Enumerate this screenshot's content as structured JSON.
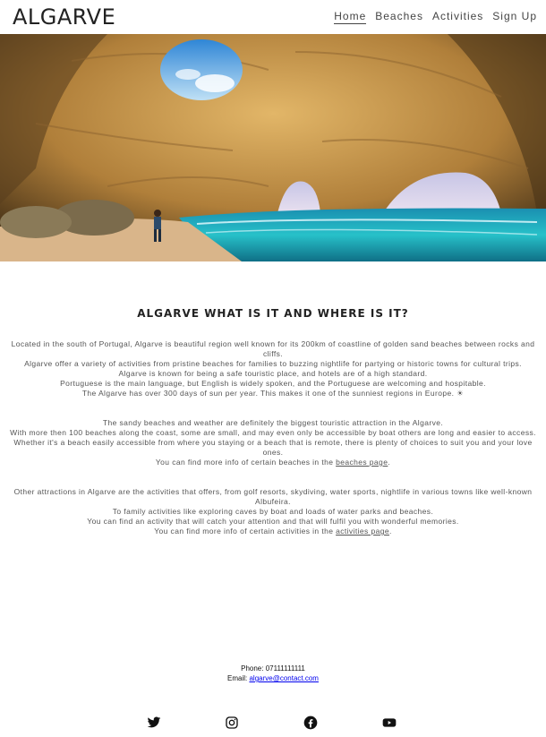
{
  "header": {
    "logo": "ALGARVE",
    "nav": [
      {
        "label": "Home",
        "active": true
      },
      {
        "label": "Beaches",
        "active": false
      },
      {
        "label": "Activities",
        "active": false
      },
      {
        "label": "Sign Up",
        "active": false
      }
    ]
  },
  "main": {
    "title": "ALGARVE WHAT IS IT AND WHERE IS IT?",
    "p1": [
      "Located in the south of Portugal, Algarve is beautiful region well known for its 200km of coastline of golden sand beaches between rocks and cliffs.",
      "Algarve offer a variety of activities from pristine beaches for families to buzzing nightlife for partying or historic towns for cultural trips.",
      "Algarve is known for being a safe touristic place, and hotels are of a high standard.",
      "Portuguese is the main language, but English is widely spoken, and the Portuguese are welcoming and hospitable.",
      "The Algarve has over 300 days of sun per year. This makes it one of the sunniest regions in Europe. ☀"
    ],
    "p2": [
      "The sandy beaches and weather are definitely the biggest touristic attraction in the Algarve.",
      "With more then 100 beaches along the coast, some are small, and may even only be accessible by boat others are long and easier to access.",
      "Whether it's a beach easily accessible from where you staying or a beach that is remote, there is plenty of choices to suit you and your love ones."
    ],
    "p2_link_prefix": "You can find more info of certain beaches in the ",
    "p2_link": "beaches page",
    "p2_link_suffix": ".",
    "p3": [
      "Other attractions in Algarve are the activities that offers, from golf resorts, skydiving, water sports, nightlife in various towns like well-known Albufeira.",
      "To family activities like exploring caves by boat and loads of water parks and beaches.",
      "You can find an activity that will catch your attention and that will fulfil you with wonderful memories."
    ],
    "p3_link_prefix": "You can find more info of certain activities in the ",
    "p3_link": "activities page",
    "p3_link_suffix": "."
  },
  "footer": {
    "phone": "Phone: 07111111111",
    "email_label": "Email: ",
    "email": "algarve@contact.com",
    "social_icons": [
      "twitter-icon",
      "instagram-icon",
      "facebook-icon",
      "youtube-icon"
    ]
  },
  "colors": {
    "text": "#444444",
    "link": "#0000ee",
    "cave_rock": "#c8923f",
    "sea": "#1fb3c4",
    "sky": "#3b8fd8"
  }
}
